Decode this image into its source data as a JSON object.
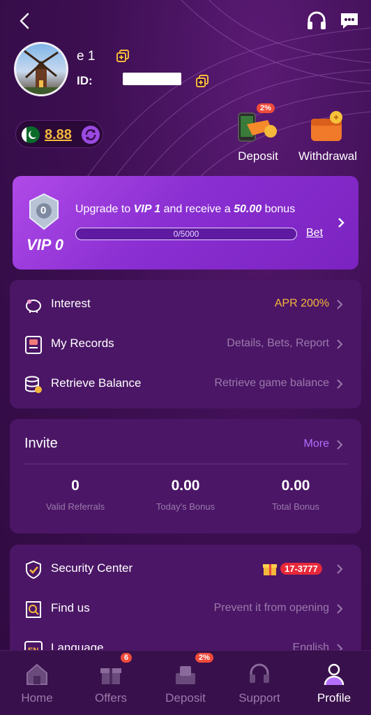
{
  "header": {
    "back_icon": "back-arrow-icon",
    "support_icon": "headset-icon",
    "chat_icon": "chat-bubble-icon"
  },
  "profile": {
    "username": "e     1",
    "id_label": "ID:",
    "copy_icon": "copy-icon"
  },
  "wallet": {
    "flag_icon": "pakistan-flag-icon",
    "balance": "8.88",
    "refresh_icon": "refresh-icon",
    "deposit_label": "Deposit",
    "deposit_badge": "2%",
    "withdraw_label": "Withdrawal"
  },
  "vip": {
    "level_digit": "0",
    "level_label": "VIP 0",
    "upgrade_prefix": "Upgrade to ",
    "upgrade_level": "VIP 1",
    "upgrade_mid": " and receive a ",
    "upgrade_amount": "50.00",
    "upgrade_suffix": " bonus",
    "progress_text": "0/5000",
    "bet_label": "Bet"
  },
  "menu1": [
    {
      "label": "Interest",
      "value": "APR 200%"
    },
    {
      "label": "My Records",
      "value": "Details, Bets, Report"
    },
    {
      "label": "Retrieve Balance",
      "value": "Retrieve game balance"
    }
  ],
  "invite": {
    "title": "Invite",
    "more": "More",
    "stats": [
      {
        "value": "0",
        "label": "Valid Referrals"
      },
      {
        "value": "0.00",
        "label": "Today's Bonus"
      },
      {
        "value": "0.00",
        "label": "Total Bonus"
      }
    ]
  },
  "menu2": [
    {
      "label": "Security Center",
      "code": "17-3777"
    },
    {
      "label": "Find us",
      "value": "Prevent it from opening"
    },
    {
      "label": "Language",
      "value": "English"
    }
  ],
  "nav": [
    {
      "label": "Home",
      "icon": "home-icon"
    },
    {
      "label": "Offers",
      "icon": "gift-icon",
      "badge": "6"
    },
    {
      "label": "Deposit",
      "icon": "deposit-icon",
      "badge": "2%"
    },
    {
      "label": "Support",
      "icon": "support-icon"
    },
    {
      "label": "Profile",
      "icon": "profile-icon",
      "active": true
    }
  ],
  "colors": {
    "background": "#3a0c4e",
    "card": "#4b1666",
    "gold": "#f5b83a",
    "accent": "#b46fff",
    "vip_card": "#9a3ee0"
  }
}
